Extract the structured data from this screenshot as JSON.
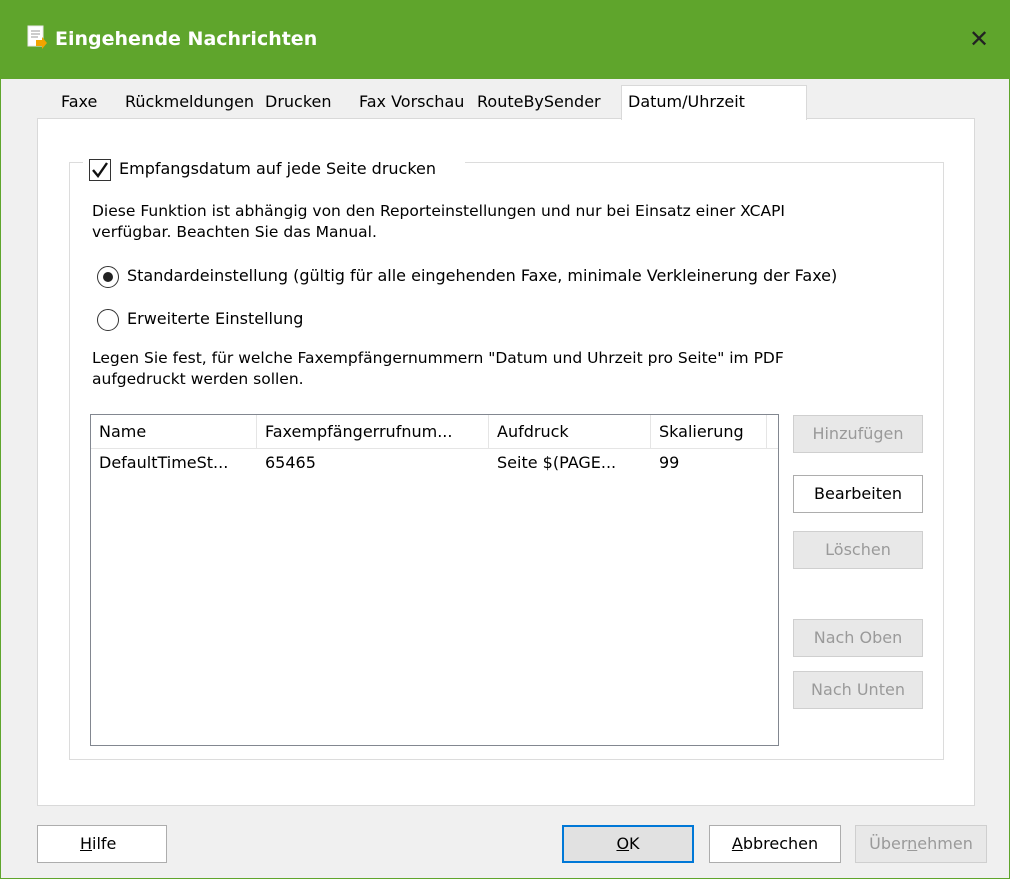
{
  "window": {
    "title": "Eingehende Nachrichten",
    "close_glyph": "✕",
    "accent_color": "#5fa52c"
  },
  "tabs": [
    {
      "label": "Faxe",
      "active": false
    },
    {
      "label": "Rückmeldungen",
      "active": false
    },
    {
      "label": "Drucken",
      "active": false
    },
    {
      "label": "Fax Vorschau",
      "active": false
    },
    {
      "label": "RouteBySender",
      "active": false
    },
    {
      "label": "Datum/Uhrzeit",
      "active": true
    }
  ],
  "settings": {
    "print_date_checkbox": {
      "label": "Empfangsdatum auf jede Seite drucken",
      "checked": true
    },
    "info_line1": "Diese Funktion ist abhängig von den Reporteinstellungen und nur bei Einsatz einer XCAPI",
    "info_line2": "verfügbar. Beachten Sie das Manual.",
    "radio_standard": {
      "label": "Standardeinstellung (gültig für alle eingehenden Faxe, minimale Verkleinerung der Faxe)",
      "selected": true
    },
    "radio_extended": {
      "label": "Erweiterte Einstellung",
      "selected": false
    },
    "hint_line1": "Legen Sie fest, für welche Faxempfängernummern \"Datum und Uhrzeit pro Seite\" im PDF",
    "hint_line2": "aufgedruckt werden sollen."
  },
  "table": {
    "columns": [
      "Name",
      "Faxempfängerrufnum...",
      "Aufdruck",
      "Skalierung"
    ],
    "rows": [
      [
        "DefaultTimeSt...",
        "65465",
        "Seite $(PAGE...",
        "99"
      ]
    ]
  },
  "side_buttons": {
    "add": "Hinzufügen",
    "edit": "Bearbeiten",
    "delete": "Löschen",
    "up": "Nach Oben",
    "down": "Nach Unten"
  },
  "footer_buttons": {
    "help_mnemonic": "H",
    "help_rest": "ilfe",
    "ok_mnemonic": "O",
    "ok_rest": "K",
    "cancel_mnemonic": "A",
    "cancel_rest": "bbrechen",
    "apply_pre": "Über",
    "apply_mnemonic": "n",
    "apply_post": "ehmen"
  }
}
